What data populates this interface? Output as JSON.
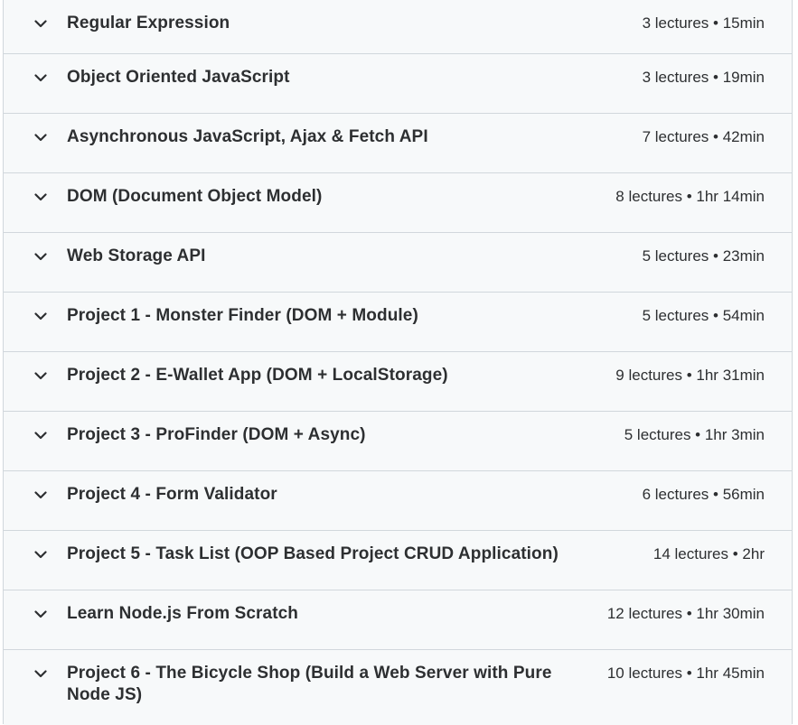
{
  "sections": [
    {
      "title": "Regular Expression",
      "meta": "3 lectures • 15min"
    },
    {
      "title": "Object Oriented JavaScript",
      "meta": "3 lectures • 19min"
    },
    {
      "title": "Asynchronous JavaScript, Ajax & Fetch API",
      "meta": "7 lectures • 42min"
    },
    {
      "title": "DOM (Document Object Model)",
      "meta": "8 lectures • 1hr 14min"
    },
    {
      "title": "Web Storage API",
      "meta": "5 lectures • 23min"
    },
    {
      "title": "Project 1 - Monster Finder (DOM + Module)",
      "meta": "5 lectures • 54min"
    },
    {
      "title": "Project 2 - E-Wallet App (DOM + LocalStorage)",
      "meta": "9 lectures • 1hr 31min"
    },
    {
      "title": "Project 3 - ProFinder (DOM + Async)",
      "meta": "5 lectures • 1hr 3min"
    },
    {
      "title": "Project 4 - Form Validator",
      "meta": "6 lectures • 56min"
    },
    {
      "title": "Project 5 - Task List (OOP Based Project CRUD Application)",
      "meta": "14 lectures • 2hr"
    },
    {
      "title": "Learn Node.js From Scratch",
      "meta": "12 lectures • 1hr 30min"
    },
    {
      "title": "Project 6 - The Bicycle Shop (Build a Web Server with Pure Node JS)",
      "meta": "10 lectures • 1hr 45min"
    }
  ],
  "icons": {
    "expand": "chevron-down-icon"
  },
  "colors": {
    "text": "#2d2f31",
    "background": "#f7f9fa",
    "border": "#d1d7dc"
  }
}
